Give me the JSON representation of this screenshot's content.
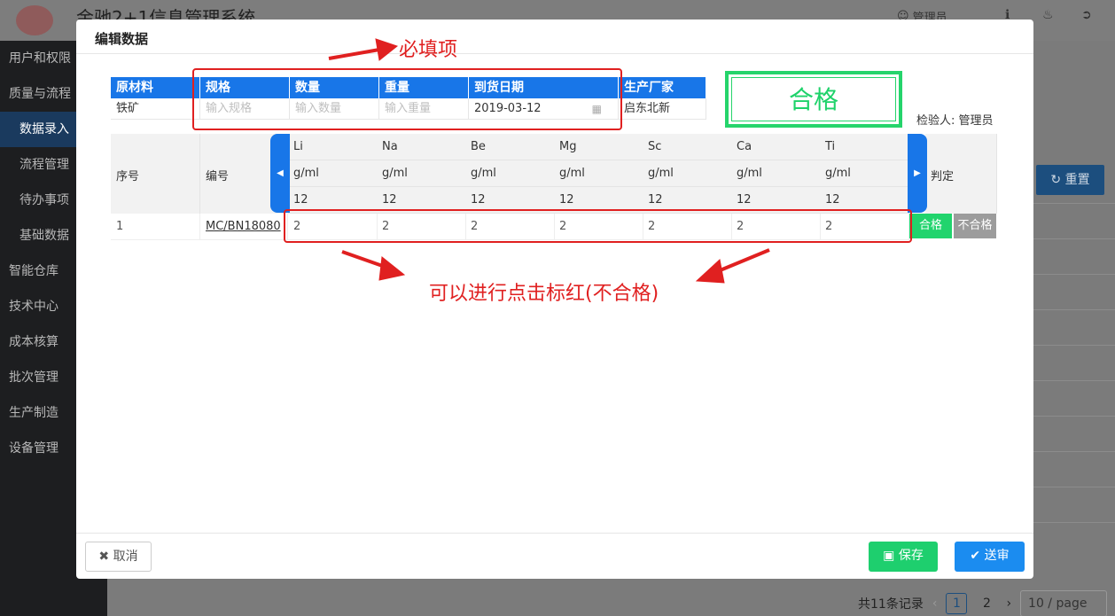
{
  "app": {
    "title": "金驰2+1信息管理系统",
    "user": "管理员"
  },
  "sidebar": {
    "items": [
      {
        "label": "用户和权限"
      },
      {
        "label": "质量与流程"
      },
      {
        "label": "数据录入"
      },
      {
        "label": "流程管理"
      },
      {
        "label": "待办事项"
      },
      {
        "label": "基础数据"
      },
      {
        "label": "智能仓库"
      },
      {
        "label": "技术中心"
      },
      {
        "label": "成本核算"
      },
      {
        "label": "批次管理"
      },
      {
        "label": "生产制造"
      },
      {
        "label": "设备管理"
      }
    ]
  },
  "main": {
    "reset_label": "重置",
    "pagination": {
      "total": "共11条记录",
      "pages": [
        "1",
        "2"
      ],
      "page_size": "10 / page"
    }
  },
  "modal": {
    "title": "编辑数据",
    "info_table": {
      "headers": [
        "原材料",
        "规格",
        "数量",
        "重量",
        "到货日期",
        "生产厂家"
      ],
      "material": "铁矿",
      "spec_placeholder": "输入规格",
      "qty_placeholder": "输入数量",
      "weight_placeholder": "输入重量",
      "arrival_date": "2019-03-12",
      "manufacturer": "启东北新"
    },
    "result_stamp": "合格",
    "inspector": "检验人: 管理员",
    "element_table": {
      "seq_header": "序号",
      "code_header": "编号",
      "judge_header": "判定",
      "elements": [
        {
          "name": "Li",
          "unit": "g/ml",
          "std": "12"
        },
        {
          "name": "Na",
          "unit": "g/ml",
          "std": "12"
        },
        {
          "name": "Be",
          "unit": "g/ml",
          "std": "12"
        },
        {
          "name": "Mg",
          "unit": "g/ml",
          "std": "12"
        },
        {
          "name": "Sc",
          "unit": "g/ml",
          "std": "12"
        },
        {
          "name": "Ca",
          "unit": "g/ml",
          "std": "12"
        },
        {
          "name": "Ti",
          "unit": "g/ml",
          "std": "12"
        }
      ],
      "row": {
        "seq": "1",
        "code": "MC/BN18080",
        "values": [
          "2",
          "2",
          "2",
          "2",
          "2",
          "2",
          "2"
        ],
        "pass_label": "合格",
        "fail_label": "不合格"
      }
    },
    "footer": {
      "cancel_label": "取消",
      "save_label": "保存",
      "submit_label": "送审"
    }
  },
  "annotations": {
    "required": "必填项",
    "click_hint": "可以进行点击标红(不合格)",
    "color": "#e02020"
  },
  "colors": {
    "header_blue": "#1876e8",
    "pass_green": "#21d46d",
    "fail_gray": "#9c9c9c"
  }
}
